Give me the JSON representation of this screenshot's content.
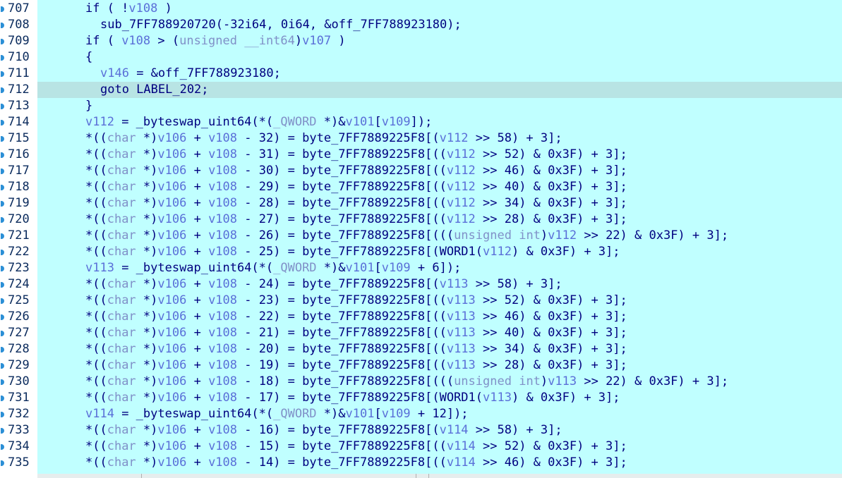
{
  "editor": {
    "highlighted_line": "712",
    "colors": {
      "background": "#c0ffff",
      "highlight": "#b8e4e4",
      "text": "#000080",
      "variable": "#5a6fd8",
      "type": "#8090c8"
    },
    "lines": [
      {
        "num": "707",
        "code": "if ( !v108 )",
        "indent": 0
      },
      {
        "num": "708",
        "code": "sub_7FF788920720(-32i64, 0i64, &off_7FF788923180);",
        "indent": 1
      },
      {
        "num": "709",
        "code": "if ( v108 > (unsigned __int64)v107 )",
        "indent": 0
      },
      {
        "num": "710",
        "code": "{",
        "indent": 0
      },
      {
        "num": "711",
        "code": "v146 = &off_7FF788923180;",
        "indent": 1
      },
      {
        "num": "712",
        "code": "goto LABEL_202;",
        "indent": 1
      },
      {
        "num": "713",
        "code": "}",
        "indent": 0
      },
      {
        "num": "714",
        "code": "v112 = _byteswap_uint64(*(_QWORD *)&v101[v109]);",
        "indent": 0
      },
      {
        "num": "715",
        "code": "*((char *)v106 + v108 - 32) = byte_7FF7889225F8[(v112 >> 58) + 3];",
        "indent": 0
      },
      {
        "num": "716",
        "code": "*((char *)v106 + v108 - 31) = byte_7FF7889225F8[((v112 >> 52) & 0x3F) + 3];",
        "indent": 0
      },
      {
        "num": "717",
        "code": "*((char *)v106 + v108 - 30) = byte_7FF7889225F8[((v112 >> 46) & 0x3F) + 3];",
        "indent": 0
      },
      {
        "num": "718",
        "code": "*((char *)v106 + v108 - 29) = byte_7FF7889225F8[((v112 >> 40) & 0x3F) + 3];",
        "indent": 0
      },
      {
        "num": "719",
        "code": "*((char *)v106 + v108 - 28) = byte_7FF7889225F8[((v112 >> 34) & 0x3F) + 3];",
        "indent": 0
      },
      {
        "num": "720",
        "code": "*((char *)v106 + v108 - 27) = byte_7FF7889225F8[((v112 >> 28) & 0x3F) + 3];",
        "indent": 0
      },
      {
        "num": "721",
        "code": "*((char *)v106 + v108 - 26) = byte_7FF7889225F8[(((unsigned int)v112 >> 22) & 0x3F) + 3];",
        "indent": 0
      },
      {
        "num": "722",
        "code": "*((char *)v106 + v108 - 25) = byte_7FF7889225F8[(WORD1(v112) & 0x3F) + 3];",
        "indent": 0
      },
      {
        "num": "723",
        "code": "v113 = _byteswap_uint64(*(_QWORD *)&v101[v109 + 6]);",
        "indent": 0
      },
      {
        "num": "724",
        "code": "*((char *)v106 + v108 - 24) = byte_7FF7889225F8[(v113 >> 58) + 3];",
        "indent": 0
      },
      {
        "num": "725",
        "code": "*((char *)v106 + v108 - 23) = byte_7FF7889225F8[((v113 >> 52) & 0x3F) + 3];",
        "indent": 0
      },
      {
        "num": "726",
        "code": "*((char *)v106 + v108 - 22) = byte_7FF7889225F8[((v113 >> 46) & 0x3F) + 3];",
        "indent": 0
      },
      {
        "num": "727",
        "code": "*((char *)v106 + v108 - 21) = byte_7FF7889225F8[((v113 >> 40) & 0x3F) + 3];",
        "indent": 0
      },
      {
        "num": "728",
        "code": "*((char *)v106 + v108 - 20) = byte_7FF7889225F8[((v113 >> 34) & 0x3F) + 3];",
        "indent": 0
      },
      {
        "num": "729",
        "code": "*((char *)v106 + v108 - 19) = byte_7FF7889225F8[((v113 >> 28) & 0x3F) + 3];",
        "indent": 0
      },
      {
        "num": "730",
        "code": "*((char *)v106 + v108 - 18) = byte_7FF7889225F8[(((unsigned int)v113 >> 22) & 0x3F) + 3];",
        "indent": 0
      },
      {
        "num": "731",
        "code": "*((char *)v106 + v108 - 17) = byte_7FF7889225F8[(WORD1(v113) & 0x3F) + 3];",
        "indent": 0
      },
      {
        "num": "732",
        "code": "v114 = _byteswap_uint64(*(_QWORD *)&v101[v109 + 12]);",
        "indent": 0
      },
      {
        "num": "733",
        "code": "*((char *)v106 + v108 - 16) = byte_7FF7889225F8[(v114 >> 58) + 3];",
        "indent": 0
      },
      {
        "num": "734",
        "code": "*((char *)v106 + v108 - 15) = byte_7FF7889225F8[((v114 >> 52) & 0x3F) + 3];",
        "indent": 0
      },
      {
        "num": "735",
        "code": "*((char *)v106 + v108 - 14) = byte_7FF7889225F8[((v114 >> 46) & 0x3F) + 3];",
        "indent": 0
      }
    ]
  }
}
